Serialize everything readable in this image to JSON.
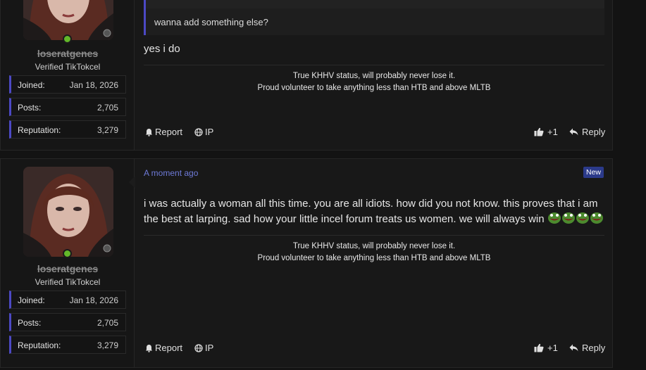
{
  "posts": [
    {
      "user": {
        "name": "loseratgenes",
        "title": "Verified TikTokcel",
        "stats": [
          {
            "label": "Joined:",
            "value": "Jan 18, 2026"
          },
          {
            "label": "Posts:",
            "value": "2,705"
          },
          {
            "label": "Reputation:",
            "value": "3,279"
          }
        ]
      },
      "quote": "wanna add something else?",
      "body": "yes i do",
      "signature": [
        "True KHHV status, will probably never lose it.",
        "Proud volunteer to take anything less than HTB and above MLTB"
      ],
      "actions": {
        "report": "Report",
        "ip": "IP",
        "like": "+1",
        "reply": "Reply"
      }
    },
    {
      "date": "A moment ago",
      "badge": "New",
      "user": {
        "name": "loseratgenes",
        "title": "Verified TikTokcel",
        "stats": [
          {
            "label": "Joined:",
            "value": "Jan 18, 2026"
          },
          {
            "label": "Posts:",
            "value": "2,705"
          },
          {
            "label": "Reputation:",
            "value": "3,279"
          }
        ]
      },
      "body": "i was actually a woman all this time. you are all idiots. how did you not know. this proves that i am the best at larping. sad how your little incel forum treats us women. we will always win",
      "signature": [
        "True KHHV status, will probably never lose it.",
        "Proud volunteer to take anything less than HTB and above MLTB"
      ],
      "actions": {
        "report": "Report",
        "ip": "IP",
        "like": "+1",
        "reply": "Reply"
      }
    }
  ],
  "icons": {
    "report": "bell-icon",
    "ip": "globe-icon",
    "like": "thumbs-up-icon",
    "reply": "reply-arrow-icon",
    "emoji": "pepe-laugh-emoji"
  },
  "colors": {
    "accent": "#4c49c4",
    "online": "#63b82a",
    "link": "#6e7ad8",
    "badge": "#2b3a8a"
  }
}
